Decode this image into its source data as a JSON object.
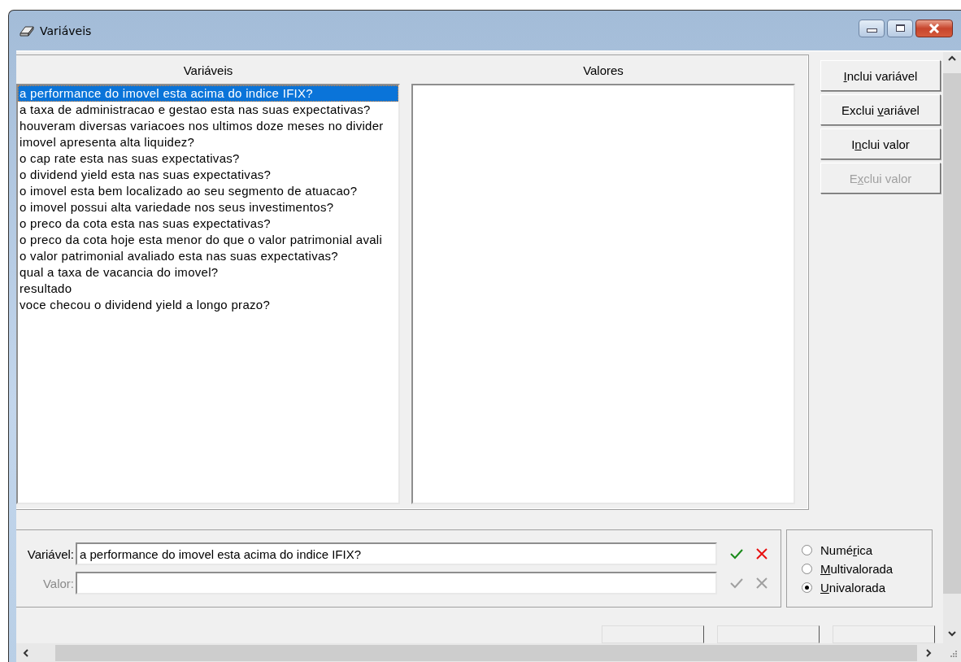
{
  "window": {
    "title": "Variáveis"
  },
  "variables_list": {
    "heading": "Variáveis",
    "items": [
      {
        "text": "a performance do imovel esta acima do indice IFIX?",
        "selected": true
      },
      {
        "text": "a taxa de administracao e gestao esta nas suas expectativas?",
        "selected": false
      },
      {
        "text": "houveram diversas variacoes nos ultimos doze meses no divider",
        "selected": false
      },
      {
        "text": "imovel apresenta alta liquidez?",
        "selected": false
      },
      {
        "text": "o cap rate esta nas suas expectativas?",
        "selected": false
      },
      {
        "text": "o dividend yield esta nas suas expectativas?",
        "selected": false
      },
      {
        "text": "o imovel esta bem localizado ao seu segmento de atuacao?",
        "selected": false
      },
      {
        "text": "o imovel possui alta variedade nos seus investimentos?",
        "selected": false
      },
      {
        "text": "o preco da cota esta nas suas expectativas?",
        "selected": false
      },
      {
        "text": "o preco da cota hoje esta menor do que o valor patrimonial avali",
        "selected": false
      },
      {
        "text": "o valor patrimonial avaliado esta nas suas expectativas?",
        "selected": false
      },
      {
        "text": "qual a taxa de vacancia do imovel?",
        "selected": false
      },
      {
        "text": "resultado",
        "selected": false
      },
      {
        "text": "voce checou o dividend yield a longo prazo?",
        "selected": false
      }
    ]
  },
  "values_list": {
    "heading": "Valores"
  },
  "buttons": [
    {
      "label": {
        "key": "I",
        "after": "nclui variável"
      },
      "disabled": false
    },
    {
      "label": {
        "before": "Exclui ",
        "key": "v",
        "after": "ariável"
      },
      "disabled": false
    },
    {
      "label": {
        "before": "I",
        "key": "n",
        "after": "clui valor"
      },
      "disabled": false
    },
    {
      "label": {
        "before": "E",
        "key": "x",
        "after": "clui valor"
      },
      "disabled": true
    }
  ],
  "fields": [
    {
      "label": "Variável:",
      "value": "a performance do imovel esta acima do indice IFIX?",
      "disabled": false
    },
    {
      "label": "Valor:",
      "disabled": true
    }
  ],
  "type_options": [
    {
      "label": {
        "before": "Numé",
        "key": "r",
        "after": "ica"
      },
      "selected": false
    },
    {
      "label": {
        "key": "M",
        "after": "ultivalorada"
      },
      "selected": false
    },
    {
      "label": {
        "key": "U",
        "after": "nivalorada"
      },
      "selected": true
    }
  ]
}
